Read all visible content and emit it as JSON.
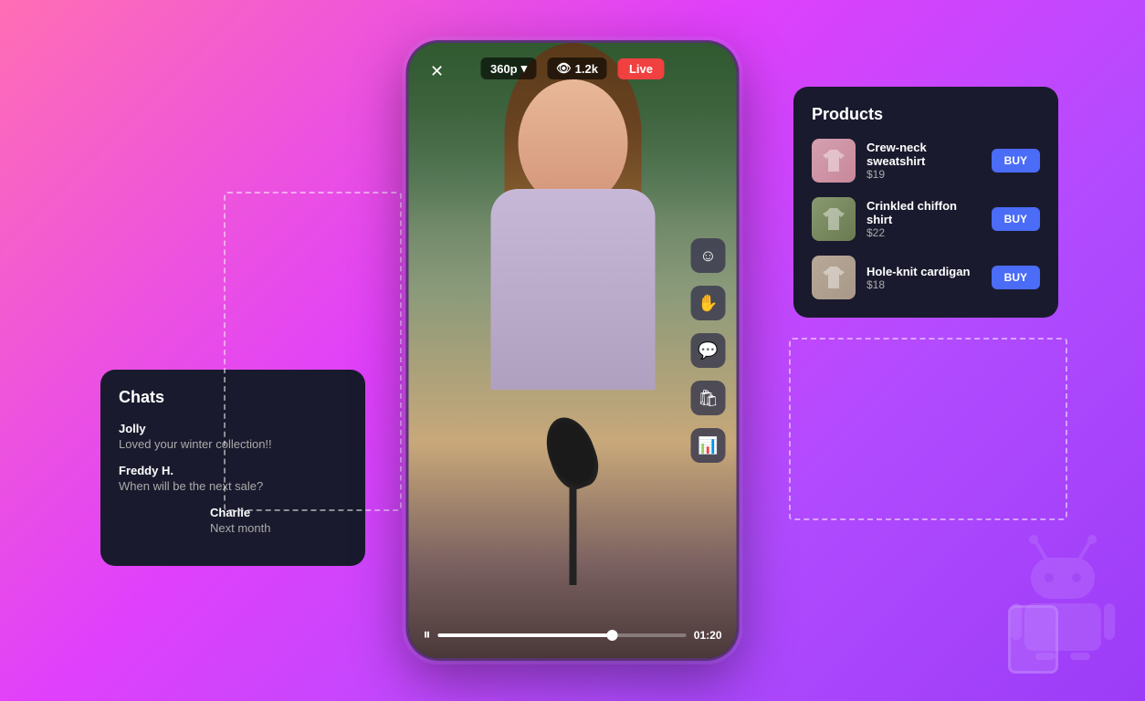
{
  "background": {
    "gradient_start": "#ff6eb4",
    "gradient_end": "#9b3cf7"
  },
  "chat": {
    "title": "Chats",
    "messages": [
      {
        "name": "Jolly",
        "text": "Loved your winter collection!!"
      },
      {
        "name": "Freddy H.",
        "text": "When will be the next sale?"
      },
      {
        "name": "Charlie",
        "text": "Next month"
      }
    ]
  },
  "products": {
    "title": "Products",
    "items": [
      {
        "name": "Crew-neck sweatshirt",
        "price": "$19",
        "img_class": "product-img-sweatshirt",
        "buy_label": "BUY"
      },
      {
        "name": "Crinkled chiffon shirt",
        "price": "$22",
        "img_class": "product-img-chiffon",
        "buy_label": "BUY"
      },
      {
        "name": "Hole-knit cardigan",
        "price": "$18",
        "img_class": "product-img-cardigan",
        "buy_label": "BUY"
      }
    ]
  },
  "video": {
    "quality": "360p",
    "viewers": "1.2k",
    "live_label": "Live",
    "time": "01:20",
    "progress_percent": 70
  },
  "icons": {
    "close": "✕",
    "dropdown_arrow": "▾",
    "eye": "👁",
    "smile": "☺",
    "hand": "✋",
    "chat_bubble": "💬",
    "bag": "🛍",
    "bar_chart": "📊",
    "pause": "⏸"
  }
}
